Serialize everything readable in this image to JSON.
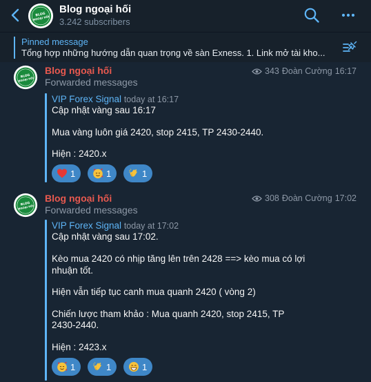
{
  "header": {
    "title": "Blog ngoại hối",
    "subscribers": "3.242 subscribers",
    "avatar_text_top": "BLOG",
    "avatar_text_bottom": "NGOẠI HỐI"
  },
  "pinned": {
    "title": "Pinned message",
    "text": "Tổng hợp những hướng dẫn quan trọng về sàn Exness.  1. Link mở tài kho..."
  },
  "messages": [
    {
      "author": "Blog ngoại hối",
      "forwarded": "Forwarded messages",
      "views": "343",
      "signature": "Đoàn Cường",
      "time": "16:17",
      "forward_source": "VIP Forex Signal",
      "forward_time": "today at 16:17",
      "lines": [
        "Cập nhật vàng sau 16:17",
        "Mua vàng luôn giá 2420, stop 2415, TP 2430-2440.",
        "Hiện : 2420.x"
      ],
      "reactions": [
        {
          "emoji": "red-heart",
          "count": "1"
        },
        {
          "emoji": "smiling-face-with-hearts",
          "count": "1"
        },
        {
          "emoji": "clapping-hands",
          "count": "1"
        }
      ]
    },
    {
      "author": "Blog ngoại hối",
      "forwarded": "Forwarded messages",
      "views": "308",
      "signature": "Đoàn Cường",
      "time": "17:02",
      "forward_source": "VIP Forex Signal",
      "forward_time": "today at 17:02",
      "lines": [
        "Cập nhật vàng sau 17:02.",
        "Kèo mua 2420 có nhịp tăng lên trên 2428 ==> kèo mua có lợi",
        "nhuận tốt.",
        "Hiện vẫn tiếp tục canh mua quanh 2420 ( vòng 2)",
        "Chiến lược tham khảo : Mua quanh 2420, stop 2415, TP",
        "2430-2440.",
        "Hiện : 2423.x"
      ],
      "reactions": [
        {
          "emoji": "smiling-face-with-hearts",
          "count": "1"
        },
        {
          "emoji": "clapping-hands",
          "count": "1"
        },
        {
          "emoji": "beaming-face",
          "count": "1"
        }
      ]
    }
  ],
  "colors": {
    "background": "#182533",
    "header": "#17212b",
    "accent": "#5eb5f7",
    "author": "#e8594f",
    "reaction": "#3f87c7",
    "avatar_green": "#1a8a3c"
  }
}
